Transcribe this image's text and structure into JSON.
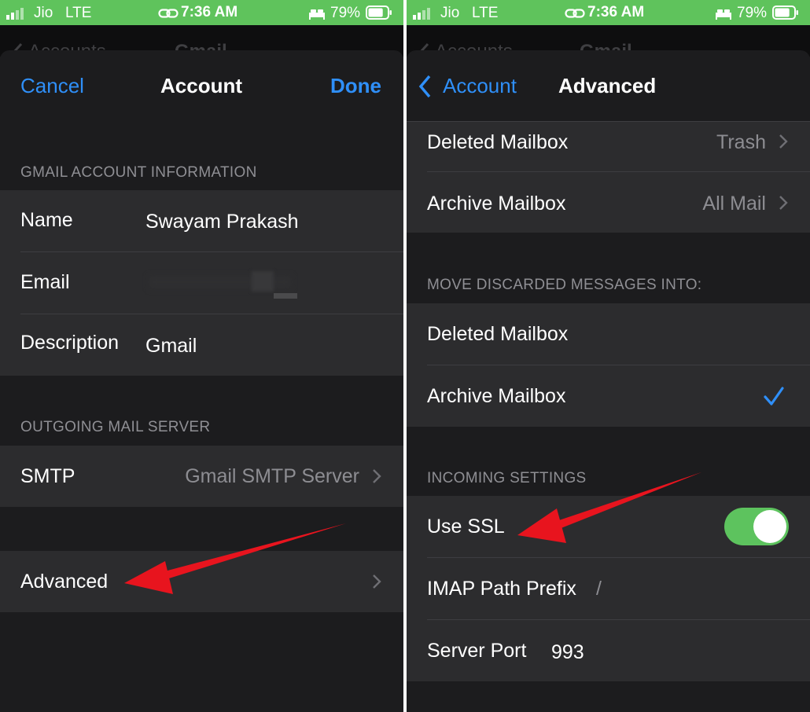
{
  "status_bar": {
    "carrier": "Jio",
    "network": "LTE",
    "time": "7:36 AM",
    "battery_percent": "79%",
    "battery_level": 0.79,
    "background_color": "#5fc35c"
  },
  "colors": {
    "accent": "#2f8ff8",
    "toggle_on": "#5dc35e",
    "arrow": "#e8141e",
    "cell_background": "#2c2c2e",
    "page_background": "#1c1c1e"
  },
  "left_screen": {
    "background_nav": {
      "back_label": "Accounts",
      "title": "Gmail"
    },
    "nav": {
      "cancel_label": "Cancel",
      "title": "Account",
      "done_label": "Done"
    },
    "account_info": {
      "header": "GMAIL ACCOUNT INFORMATION",
      "rows": [
        {
          "label": "Name",
          "value": "Swayam Prakash"
        },
        {
          "label": "Email",
          "value": ""
        },
        {
          "label": "Description",
          "value": "Gmail"
        }
      ]
    },
    "outgoing": {
      "header": "OUTGOING MAIL SERVER",
      "smtp_label": "SMTP",
      "smtp_value": "Gmail SMTP Server"
    },
    "advanced_label": "Advanced"
  },
  "right_screen": {
    "background_nav": {
      "back_label": "Accounts",
      "title": "Gmail"
    },
    "nav": {
      "back_label": "Account",
      "title": "Advanced"
    },
    "mailbox_behaviors": [
      {
        "label": "Deleted Mailbox",
        "value": "Trash"
      },
      {
        "label": "Archive Mailbox",
        "value": "All Mail"
      }
    ],
    "discarded": {
      "header": "MOVE DISCARDED MESSAGES INTO:",
      "options": [
        {
          "label": "Deleted Mailbox",
          "selected": false
        },
        {
          "label": "Archive Mailbox",
          "selected": true
        }
      ]
    },
    "incoming": {
      "header": "INCOMING SETTINGS",
      "use_ssl_label": "Use SSL",
      "use_ssl_on": true,
      "imap_prefix_label": "IMAP Path Prefix",
      "imap_prefix_value": "/",
      "server_port_label": "Server Port",
      "server_port_value": "993"
    }
  }
}
